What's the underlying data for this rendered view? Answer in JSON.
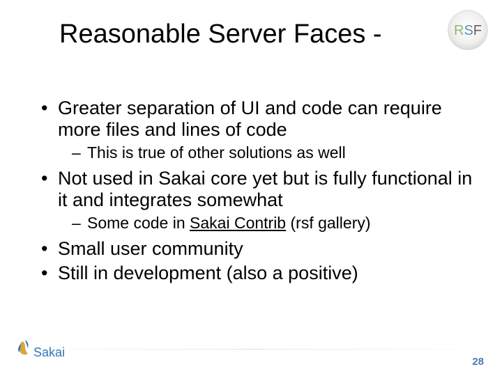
{
  "title": "Reasonable Server Faces -",
  "bullets": [
    {
      "level": 1,
      "text": "Greater separation of UI and code can require more files and lines of code"
    },
    {
      "level": 2,
      "text": "This is true of other solutions as well"
    },
    {
      "level": 1,
      "text": "Not used in Sakai core yet but is fully functional in it and integrates somewhat"
    },
    {
      "level": 2,
      "prefix": "Some code in ",
      "link": "Sakai Contrib",
      "suffix": " (rsf gallery)"
    },
    {
      "level": 1,
      "text": "Small user community"
    },
    {
      "level": 1,
      "text": "Still in development (also a positive)"
    }
  ],
  "rsf_badge_text": "RSF",
  "sakai_logo_text": "Sakai",
  "page_number": "28",
  "colors": {
    "rsf_green": "#8fb976",
    "rsf_blue": "#5a8fb8",
    "sakai_blue": "#2f78b6",
    "sakai_orange": "#d9a53f"
  }
}
